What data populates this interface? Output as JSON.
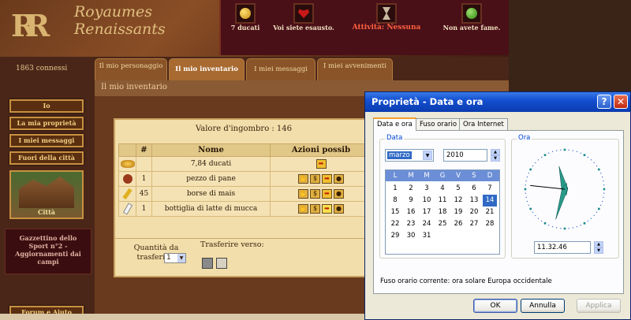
{
  "game": {
    "logo_mark": "RR",
    "logo_title": "Royaumes Renaissants",
    "online": "1863 connessi",
    "stats": [
      {
        "label": "7 ducati",
        "icon": "coin-icon"
      },
      {
        "label": "Voi siete esausto.",
        "icon": "heart-icon"
      },
      {
        "label": "Attività: Nessuna",
        "icon": "hourglass-icon"
      },
      {
        "label": "Non avete fame.",
        "icon": "apple-icon"
      }
    ],
    "tabs": [
      {
        "label": "Il mio personaggio"
      },
      {
        "label": "Il mio inventario",
        "active": true
      },
      {
        "label": "I miei messaggi"
      },
      {
        "label": "I miei avvenimenti"
      }
    ],
    "crumb": "Il mio inventario",
    "sidebar": [
      "Io",
      "La mia proprietà",
      "I miei messaggi",
      "Fuori della città"
    ],
    "city_label": "Città",
    "gazette": "Gazzettino dello Sport n°2 - Aggiornamenti dai campi",
    "forum": "Forum e Aiuto",
    "encumbrance": "Valore d'ingombro : 146",
    "table_headers": [
      "#",
      "Nome",
      "Azioni possib"
    ],
    "items": [
      {
        "qty": "",
        "name": "7,84 ducati",
        "icon": "coins-icon"
      },
      {
        "qty": "1",
        "name": "pezzo di pane",
        "icon": "bread-icon"
      },
      {
        "qty": "45",
        "name": "borse di mais",
        "icon": "corn-icon"
      },
      {
        "qty": "1",
        "name": "bottiglia di latte di mucca",
        "icon": "milk-bottle-icon"
      }
    ],
    "qty_label": "Quantità da trasferire:",
    "qty_value": "1",
    "transfer_label": "Trasferire verso:"
  },
  "dialog": {
    "title": "Proprietà - Data e ora",
    "tabs": [
      "Data e ora",
      "Fuso orario",
      "Ora Internet"
    ],
    "date_group": "Data",
    "month": "marzo",
    "year": "2010",
    "weekdays": [
      "L",
      "M",
      "M",
      "G",
      "V",
      "S",
      "D"
    ],
    "selected_day": 14,
    "time_group": "Ora",
    "time": "11.32.46",
    "tz_label": "Fuso orario corrente:  ora solare Europa occidentale",
    "ok": "OK",
    "cancel": "Annulla",
    "apply": "Applica"
  }
}
